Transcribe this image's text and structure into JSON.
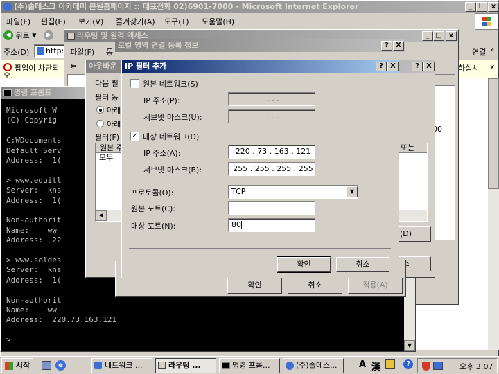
{
  "ie": {
    "title": "(주)솔데스크 아카데미 본원홈페이지 :: 대표전화 02)6901-7000 - Microsoft Internet Explorer",
    "menu": [
      "파일(F)",
      "편집(E)",
      "보기(V)",
      "즐겨찾기(A)",
      "도구(T)",
      "도움말(H)"
    ],
    "back_label": "뒤로",
    "address_label": "주소(D)",
    "address_value": "http:",
    "links_label": "연결",
    "infobar_text": "팝업이 차단되",
    "infobar_right": "하십시",
    "infobar_right2": "오."
  },
  "rras": {
    "title": "라우팅 및 원격 액세스",
    "menu": [
      "파일(F)",
      "동"
    ]
  },
  "console": {
    "title": "명령 프롬프",
    "lines": [
      "Microsoft W",
      "(C) Copyrig",
      "",
      "C:WDocuments",
      "Default Serv",
      "Address:  1(",
      "",
      "> www.eduitl",
      "Server:  kns",
      "Address:  1(",
      "",
      "Non-authorit",
      "Name:    ww",
      "Address:  22",
      "",
      "> www.soldes",
      "Server:  kns",
      "Address:  1(",
      "",
      "Non-authorit",
      "Name:    ww",
      "Address:  220.73.163.121",
      "",
      ">"
    ]
  },
  "outbound": {
    "title": "아웃바운",
    "text1": "다음 필",
    "text2": "필터 동",
    "radio1": "아래",
    "radio2": "아래",
    "filters_label": "필터(F)",
    "col1": "원본 주",
    "row1": "모두",
    "right_col": "또는 ",
    "right_btn": "(D)",
    "cancel_partial": "소"
  },
  "lan": {
    "title": "로컬 영역 연결 등록 정보",
    "right_cell": "00",
    "ok_label": "확인",
    "cancel_label": "취소",
    "apply_label": "적용(A)"
  },
  "ip_filter": {
    "title": "IP 필터 추가",
    "help": "?",
    "close": "X",
    "source_network_label": "원본 네트워크(S)",
    "source_network_checked": false,
    "src_ip_label": "IP 주소(P):",
    "src_mask_label": "서브넷 마스크(U):",
    "src_ip_value": ".      .      .",
    "src_mask_value": ".      .      .",
    "dest_network_label": "대상 네트워크(D)",
    "dest_network_checked": true,
    "dst_ip_label": "IP 주소(A):",
    "dst_mask_label": "서브넷 마스크(B):",
    "dst_ip_value": "220  .  73  .  163  .  121",
    "dst_mask_value": "255  .  255  .  255  .  255",
    "protocol_label": "프로토콜(O):",
    "protocol_value": "TCP",
    "src_port_label": "원본 포트(C):",
    "src_port_value": "",
    "dst_port_label": "대상 포트(N):",
    "dst_port_value": "80",
    "ok_label": "확인",
    "cancel_label": "취소"
  },
  "taskbar": {
    "start_label": "시작",
    "tasks": [
      "네트워크 ...",
      "라우팅 ...",
      "명령 프롬...",
      "(주)솔데스..."
    ],
    "ime_a": "A",
    "ime_han": "漢",
    "clock": "오후 3:07"
  }
}
